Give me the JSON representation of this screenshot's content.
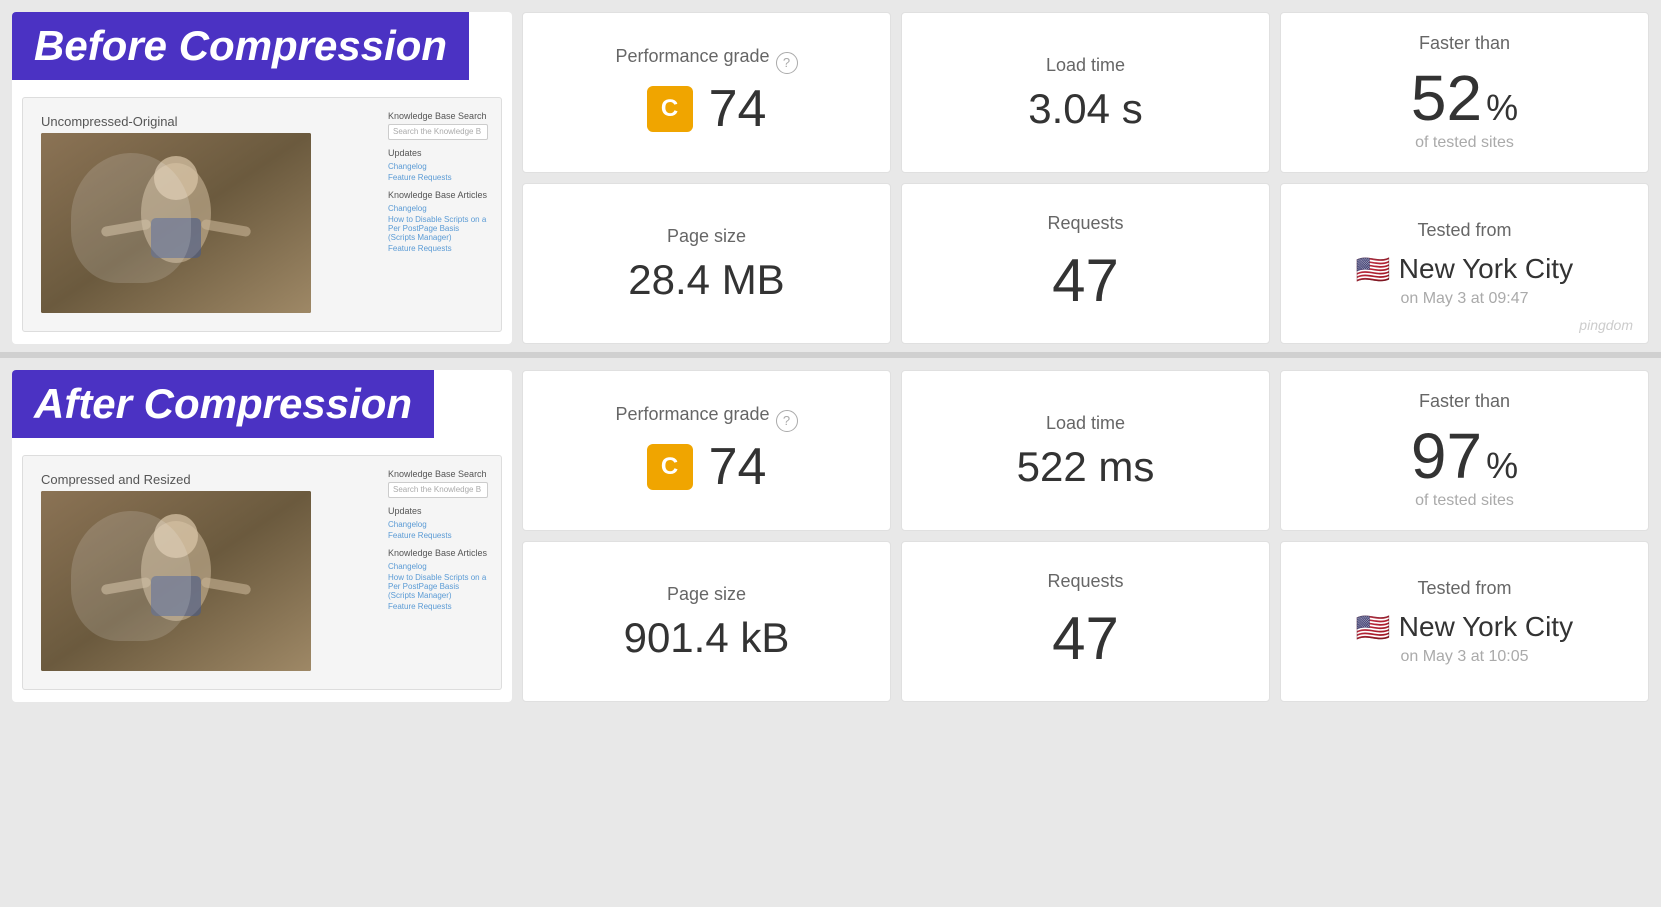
{
  "before": {
    "section_label": "Before Compression",
    "screenshot": {
      "title": "Uncompressed-Original",
      "search_label": "Knowledge Base Search",
      "search_placeholder": "Search the Knowledge B",
      "updates_label": "Updates",
      "updates_links": [
        "Changelog",
        "Feature Requests"
      ],
      "articles_label": "Knowledge Base Articles",
      "articles_links": [
        "Changelog",
        "How to Disable Scripts on a Per PostPage Basis (Scripts Manager)",
        "Feature Requests"
      ]
    },
    "metrics": {
      "performance_label": "Performance grade",
      "grade_letter": "C",
      "grade_number": "74",
      "load_time_label": "Load time",
      "load_time_value": "3.04 s",
      "faster_than_label": "Faster than",
      "faster_than_value": "52",
      "faster_than_unit": "%",
      "faster_than_sub": "of tested sites",
      "page_size_label": "Page size",
      "page_size_value": "28.4 MB",
      "requests_label": "Requests",
      "requests_value": "47",
      "tested_from_label": "Tested from",
      "tested_from_city": "New York City",
      "tested_from_date": "on May 3 at 09:47"
    }
  },
  "after": {
    "section_label": "After Compression",
    "screenshot": {
      "title": "Compressed and Resized",
      "search_label": "Knowledge Base Search",
      "search_placeholder": "Search the Knowledge B",
      "updates_label": "Updates",
      "updates_links": [
        "Changelog",
        "Feature Requests"
      ],
      "articles_label": "Knowledge Base Articles",
      "articles_links": [
        "Changelog",
        "How to Disable Scripts on a Per PostPage Basis (Scripts Manager)",
        "Feature Requests"
      ]
    },
    "metrics": {
      "performance_label": "Performance grade",
      "grade_letter": "C",
      "grade_number": "74",
      "load_time_label": "Load time",
      "load_time_value": "522 ms",
      "faster_than_label": "Faster than",
      "faster_than_value": "97",
      "faster_than_unit": "%",
      "faster_than_sub": "of tested sites",
      "page_size_label": "Page size",
      "page_size_value": "901.4 kB",
      "requests_label": "Requests",
      "requests_value": "47",
      "tested_from_label": "Tested from",
      "tested_from_city": "New York City",
      "tested_from_date": "on May 3 at 10:05"
    }
  },
  "pingdom_watermark": "pingdom"
}
